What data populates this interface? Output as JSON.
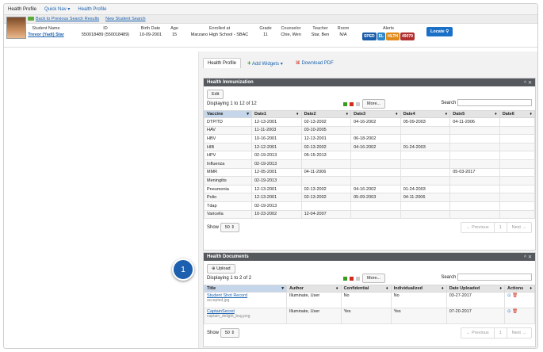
{
  "topnav": {
    "health_profile": "Health Profile",
    "quick_nav": "Quick Nav",
    "health_profile_link": "Health Profile"
  },
  "searchbar": {
    "back": "Back to Previous Search Results",
    "new_search": "New Student Search"
  },
  "student": {
    "headers": {
      "name": "Student Name",
      "id": "ID",
      "birth": "Birth Date",
      "age": "Age",
      "enrolled": "Enrolled at",
      "grade": "Grade",
      "counselor": "Counselor",
      "teacher": "Teacher",
      "room": "Room",
      "alerts": "Alerts"
    },
    "name": "Trevor (Yadi) Star",
    "id": "550018489 (550018489)",
    "birth": "10-09-2001",
    "age": "15",
    "enrolled": "Marzano High School - SBAC",
    "grade": "11",
    "counselor": "Chie, Wen",
    "teacher": "Star, Ben",
    "room": "N/A",
    "alerts": [
      {
        "label": "SPED",
        "color": "#1a5ca8"
      },
      {
        "label": "EL",
        "color": "#2b87c8"
      },
      {
        "label": "HLTH",
        "color": "#e08a1a"
      },
      {
        "label": "49079",
        "color": "#b12f2f"
      }
    ],
    "locate": "Locate"
  },
  "tabs": {
    "profile": "Health Profile",
    "add_widgets": "Add Widgets",
    "download_pdf": "Download PDF"
  },
  "immunization": {
    "title": "Health Immunization",
    "edit": "Edit",
    "displaying": "Displaying 1 to 12 of 12",
    "more": "More...",
    "search_label": "Search",
    "columns": [
      "Vaccine",
      "Date1",
      "Date2",
      "Date3",
      "Date4",
      "Date5",
      "Date6"
    ],
    "rows": [
      [
        "DTP/TD",
        "12-13-2001",
        "02-13-2002",
        "04-16-2002",
        "05-09-2003",
        "04-11-2006",
        ""
      ],
      [
        "HAV",
        "11-11-2003",
        "03-10-2005",
        "",
        "",
        "",
        ""
      ],
      [
        "HBV",
        "10-16-2001",
        "12-13-2001",
        "06-18-2002",
        "",
        "",
        ""
      ],
      [
        "HIB",
        "12-12-2001",
        "02-13-2002",
        "04-16-2002",
        "01-24-2003",
        "",
        ""
      ],
      [
        "HPV",
        "02-19-2013",
        "05-15-2013",
        "",
        "",
        "",
        ""
      ],
      [
        "Influenza",
        "02-19-2013",
        "",
        "",
        "",
        "",
        ""
      ],
      [
        "MMR",
        "12-05-2001",
        "04-11-2006",
        "",
        "",
        "05-03-2017",
        ""
      ],
      [
        "Meningitis",
        "02-19-2013",
        "",
        "",
        "",
        "",
        ""
      ],
      [
        "Pneumonia",
        "12-13-2001",
        "02-13-2002",
        "04-16-2002",
        "01-24-2003",
        "",
        ""
      ],
      [
        "Polio",
        "12-13-2001",
        "02-13-2002",
        "05-09-2003",
        "04-11-2006",
        "",
        ""
      ],
      [
        "Tdap",
        "02-19-2013",
        "",
        "",
        "",
        "",
        ""
      ],
      [
        "Varicella",
        "10-23-2002",
        "12-04-2007",
        "",
        "",
        "",
        ""
      ]
    ],
    "show_label": "Show",
    "show_value": "50",
    "prev": "← Previous",
    "page": "1",
    "next": "Next →"
  },
  "documents": {
    "title": "Health Documents",
    "upload": "Upload",
    "displaying": "Displaying 1 to 2 of 2",
    "more": "More...",
    "search_label": "Search",
    "columns": [
      "Title",
      "Author",
      "Confidential",
      "Individualized",
      "Date Uploaded",
      "Actions"
    ],
    "rows": [
      {
        "title": "Student Shot Record",
        "file": "accepted.jpg",
        "author": "Illuminate, User",
        "confidential": "No",
        "individualized": "No",
        "date": "03-27-2017"
      },
      {
        "title": "CaptainSecret",
        "file": "captain_delight_bug.png",
        "author": "Illuminate, User",
        "confidential": "Yes",
        "individualized": "Yes",
        "date": "07-20-2017"
      }
    ],
    "show_label": "Show",
    "show_value": "50",
    "prev": "← Previous",
    "page": "1",
    "next": "Next →"
  },
  "marker": {
    "label": "1"
  }
}
